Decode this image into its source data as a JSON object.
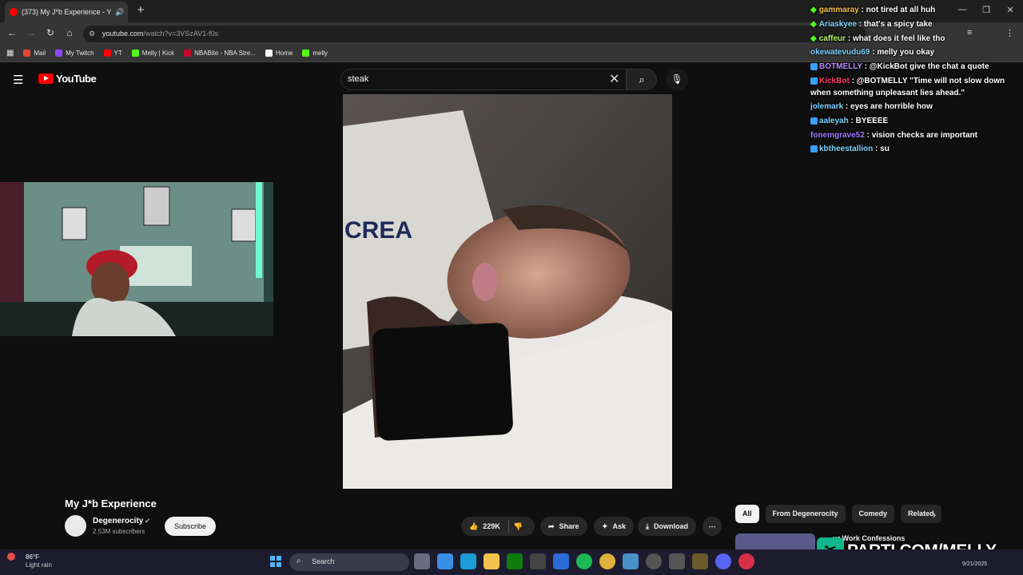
{
  "browser": {
    "tab_title": "(373) My J*b Experience - Y",
    "new_tab": "+",
    "url_host": "youtube.com",
    "url_path": "/watch?v=3VSzAV1-f0s",
    "bookmarks": [
      {
        "label": "Mail",
        "color": "#ea4335"
      },
      {
        "label": "My Twitch",
        "color": "#9146ff"
      },
      {
        "label": "YT",
        "color": "#ff0000"
      },
      {
        "label": "Melly | Kick",
        "color": "#53fc18"
      },
      {
        "label": "NBABite - NBA Stre...",
        "color": "#c9082a"
      },
      {
        "label": "Home",
        "color": "#ffffff"
      },
      {
        "label": "melly",
        "color": "#53fc18"
      }
    ]
  },
  "youtube": {
    "logo_text": "YouTube",
    "search_value": "steak",
    "video_title": "My J*b Experience",
    "channel_name": "Degenerocity",
    "subscribers": "2.53M subscribers",
    "subscribe_label": "Subscribe",
    "likes": "229K",
    "share_label": "Share",
    "ask_label": "Ask",
    "download_label": "Download",
    "chips": [
      "All",
      "From Degenerocity",
      "Comedy",
      "Related"
    ],
    "rec_title": "ur Work Confessions"
  },
  "chat": [
    {
      "user": "gammaray",
      "text": " : not tired at all huh",
      "color": "#f5c542",
      "badge": "gem"
    },
    {
      "user": "Ariaskyee",
      "text": " : that's a spicy take",
      "color": "#7fd4ff",
      "badge": "gem"
    },
    {
      "user": "caffeur",
      "text": " : what does it feel like tho",
      "color": "#b6f56b",
      "badge": "gem"
    },
    {
      "user": "okewatevudu69",
      "text": " : melly you okay",
      "color": "#7fd4ff",
      "badge": "none"
    },
    {
      "user": "BOTMELLY",
      "text": " : @KickBot give the chat a quote",
      "color": "#b98cff",
      "badge": "bot"
    },
    {
      "user": "KickBot",
      "text": " : @BOTMELLY \"Time will not slow down when something unpleasant lies ahead.\"",
      "color": "#ff3b6b",
      "badge": "bot",
      "wrap": true
    },
    {
      "user": "jolemark",
      "text": " : eyes are horrible how",
      "color": "#7fd4ff",
      "badge": "none"
    },
    {
      "user": "aaleyah",
      "text": " : BYEEEE",
      "color": "#7fd4ff",
      "badge": "sub"
    },
    {
      "user": "fonemgrave52",
      "text": " : vision checks are important",
      "color": "#9b7bff",
      "badge": "none"
    },
    {
      "user": "kbtheestallion",
      "text": " : su",
      "color": "#7fd4ff",
      "badge": "sub"
    }
  ],
  "promo": {
    "text": "PARTI.COM/MELLY"
  },
  "taskbar": {
    "temp": "86°F",
    "condition": "Light rain",
    "search_placeholder": "Search",
    "date": "9/21/2025"
  }
}
